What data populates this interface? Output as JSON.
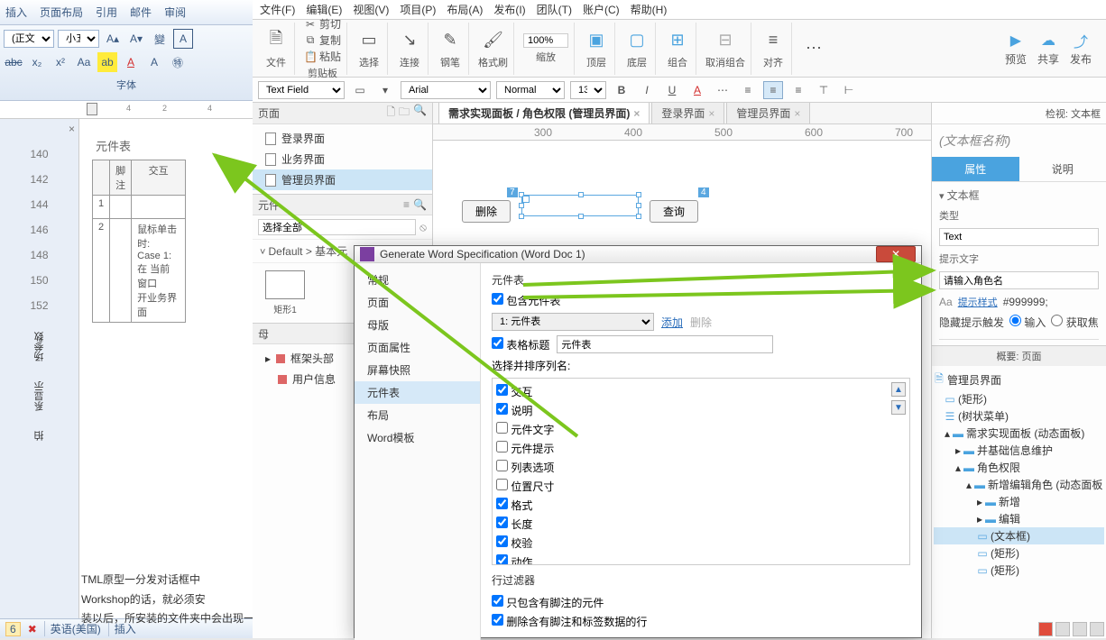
{
  "word": {
    "tabs": [
      "插入",
      "页面布局",
      "引用",
      "邮件",
      "审阅"
    ],
    "style_sel": "(正文)",
    "size_sel": "小五",
    "group_label": "字体",
    "side_options": [
      "场参数",
      "系显示",
      "拍"
    ],
    "vruler_marks": [
      "140",
      "142",
      "144",
      "146",
      "148",
      "150",
      "152"
    ],
    "table_title": "元件表",
    "th_note": "脚注",
    "th_interact": "交互",
    "row1_idx": "1",
    "row2_idx": "2",
    "row2_text": "鼠标单击时:\nCase 1:\n在 当前窗口\n开业务界面",
    "status_num": "6",
    "status_lang": "英语(美国)",
    "status_insert": "插入",
    "doc_line1": "TML原型一分发对话框中",
    "doc_line2": "Workshop的话，就必须安",
    "doc_line3": "装以后，所安装的文件夹中会出现一个hn"
  },
  "axure": {
    "menu": [
      "文件(F)",
      "编辑(E)",
      "视图(V)",
      "项目(P)",
      "布局(A)",
      "发布(I)",
      "团队(T)",
      "账户(C)",
      "帮助(H)"
    ],
    "tool_file": "文件",
    "tool_clip": "剪贴板",
    "tool_cut": "剪切",
    "tool_copy": "复制",
    "tool_paste": "粘贴",
    "tool_sel": "选择",
    "tool_connect": "连接",
    "tool_pen": "钢笔",
    "tool_point": "格式刷",
    "zoom_val": "100%",
    "tool_zoom": "缩放",
    "tool_top": "顶层",
    "tool_bottom": "底层",
    "tool_group": "组合",
    "tool_ungroup": "取消组合",
    "tool_align": "对齐",
    "rt_preview": "预览",
    "rt_share": "共享",
    "rt_publish": "发布",
    "fmt_field": "Text Field",
    "fmt_font": "Arial",
    "fmt_weight": "Normal",
    "fmt_size": "13",
    "pages_hdr": "页面",
    "page1": "登录界面",
    "page2": "业务界面",
    "page3": "管理员界面",
    "lib_hdr": "元件",
    "lib_selectall": "选择全部",
    "lib_path": "Default > 基本元",
    "shape_rect": "矩形1",
    "masters_hdr": "母",
    "master1": "框架头部",
    "master2": "用户信息",
    "tab1": "需求实现面板 / 角色权限 (管理员界面)",
    "tab2": "登录界面",
    "tab3": "管理员界面",
    "ruler_300": "300",
    "ruler_400": "400",
    "ruler_500": "500",
    "ruler_600": "600",
    "ruler_700": "700",
    "btn_delete": "删除",
    "btn_query": "查询",
    "dim1": "7",
    "dim2": "4",
    "insp_hdr": "检视: 文本框",
    "insp_name": "(文本框名称)",
    "insp_tab_prop": "属性",
    "insp_tab_note": "说明",
    "insp_sect_textbox": "文本框",
    "insp_type_lbl": "类型",
    "insp_type_val": "Text",
    "insp_hint_lbl": "提示文字",
    "insp_hint_val": "请输入角色名",
    "insp_hint_style": "提示样式",
    "insp_hint_color": "#999999;",
    "insp_hide_hint": "隐藏提示触发",
    "insp_radio1": "输入",
    "insp_radio2": "获取焦",
    "outline_hdr": "概要: 页面",
    "ot_root": "管理员界面",
    "ot_rect": "(矩形)",
    "ot_menu": "(树状菜单)",
    "ot_dynpanel": "需求实现面板 (动态面板)",
    "ot_maint": "并基础信息维护",
    "ot_role": "角色权限",
    "ot_addedit": "新增编辑角色 (动态面板",
    "ot_add": "新增",
    "ot_edit": "编辑",
    "ot_textbox": "(文本框)",
    "ot_rect2": "(矩形)",
    "ot_rect3": "(矩形)"
  },
  "dialog": {
    "title": "Generate Word Specification (Word Doc 1)",
    "nav": [
      "常规",
      "页面",
      "母版",
      "页面属性",
      "屏幕快照",
      "元件表",
      "布局",
      "Word模板"
    ],
    "sec_title": "元件表",
    "include_table": "包含元件表",
    "table_sel": "1: 元件表",
    "add": "添加",
    "del": "删除",
    "table_title_lbl": "表格标题",
    "table_title_val": "元件表",
    "sort_lbl": "选择并排序列名:",
    "cols": [
      {
        "label": "交互",
        "checked": true
      },
      {
        "label": "说明",
        "checked": true
      },
      {
        "label": "元件文字",
        "checked": false
      },
      {
        "label": "元件提示",
        "checked": false
      },
      {
        "label": "列表选项",
        "checked": false
      },
      {
        "label": "位置尺寸",
        "checked": false
      },
      {
        "label": "格式",
        "checked": true
      },
      {
        "label": "长度",
        "checked": true
      },
      {
        "label": "校验",
        "checked": true
      },
      {
        "label": "动作",
        "checked": true
      }
    ],
    "filter_title": "行过滤器",
    "filter1": "只包含有脚注的元件",
    "filter2": "删除含有脚注和标签数据的行"
  }
}
